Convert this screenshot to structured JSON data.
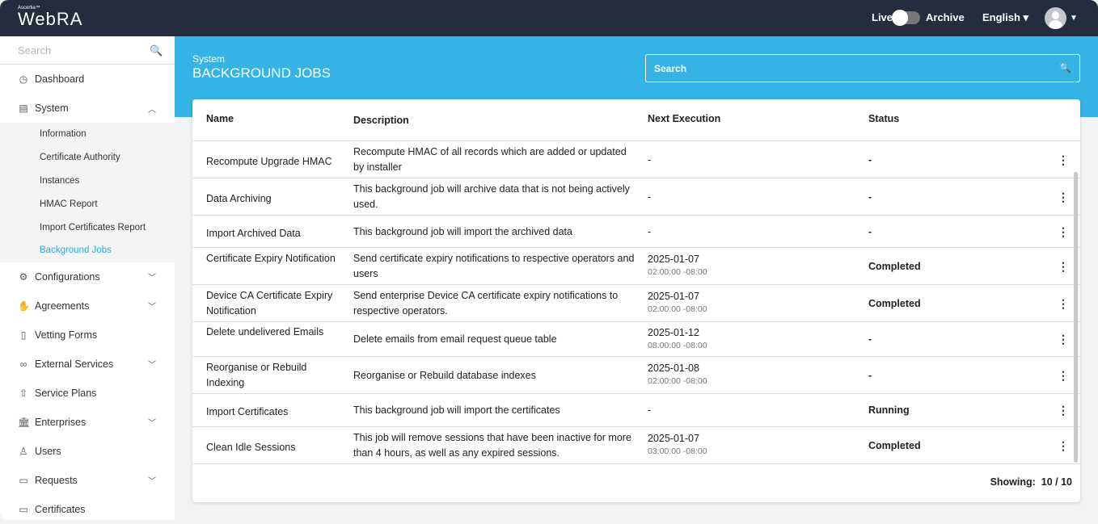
{
  "app": {
    "brand_small": "Ascertia™",
    "brand": "WebRA",
    "live": "Live",
    "archive": "Archive",
    "language": "English ▾"
  },
  "sidebar": {
    "search_placeholder": "Search",
    "items": [
      {
        "label": "Dashboard",
        "icon": "◷"
      },
      {
        "label": "System",
        "icon": "▤"
      }
    ],
    "sub": [
      "Information",
      "Certificate Authority",
      "Instances",
      "HMAC Report",
      "Import Certificates Report",
      "Background Jobs"
    ],
    "items2": [
      {
        "label": "Configurations",
        "icon": "⚙",
        "chev": true
      },
      {
        "label": "Agreements",
        "icon": "✋",
        "chev": true
      },
      {
        "label": "Vetting Forms",
        "icon": "▯",
        "chev": false
      },
      {
        "label": "External Services",
        "icon": "∞",
        "chev": true
      },
      {
        "label": "Service Plans",
        "icon": "⇧",
        "chev": false
      },
      {
        "label": "Enterprises",
        "icon": "🏛",
        "chev": true
      },
      {
        "label": "Users",
        "icon": "♙",
        "chev": false
      },
      {
        "label": "Requests",
        "icon": "▭",
        "chev": true
      },
      {
        "label": "Certificates",
        "icon": "▭",
        "chev": false
      }
    ]
  },
  "page": {
    "crumb": "System",
    "title": "BACKGROUND JOBS",
    "search_placeholder": "Search"
  },
  "table": {
    "headers": [
      "Name",
      "Description",
      "Next Execution",
      "Status"
    ],
    "rows": [
      {
        "name": "Recompute Upgrade HMAC",
        "desc": "Recompute HMAC of all records which are added or updated by installer",
        "date": "-",
        "time": "",
        "status": "-",
        "h": 46
      },
      {
        "name": "Data Archiving",
        "desc": "This background job will archive data that is not being actively used.",
        "date": "-",
        "time": "",
        "status": "-",
        "h": 46
      },
      {
        "name": "Import Archived Data",
        "desc": "This background job will import the archived data",
        "date": "-",
        "time": "",
        "status": "-",
        "h": 40
      },
      {
        "name": "Certificate Expiry Notification",
        "desc": "Send certificate expiry notifications to respective operators and users",
        "date": "2025-01-07",
        "time": "02:00:00 -08:00",
        "status": "Completed",
        "h": 46
      },
      {
        "name": "Device CA Certificate Expiry Notification",
        "desc": "Send enterprise Device CA certificate expiry notifications to respective operators.",
        "date": "2025-01-07",
        "time": "02:00:00 -08:00",
        "status": "Completed",
        "h": 46
      },
      {
        "name": "Delete undelivered Emails",
        "desc": "Delete emails from email request queue table",
        "date": "2025-01-12",
        "time": "08:00:00 -08:00",
        "status": "-",
        "h": 43
      },
      {
        "name": "Reorganise or Rebuild Indexing",
        "desc": "Reorganise or Rebuild database indexes",
        "date": "2025-01-08",
        "time": "02:00:00 -08:00",
        "status": "-",
        "h": 46
      },
      {
        "name": "Import Certificates",
        "desc": "This background job will import the certificates",
        "date": "-",
        "time": "",
        "status": "Running",
        "h": 41
      },
      {
        "name": "Clean Idle Sessions",
        "desc": "This job will remove sessions that have been inactive for more than 4 hours, as well as any expired sessions.",
        "date": "2025-01-07",
        "time": "03:00:00 -08:00",
        "status": "Completed",
        "h": 46
      }
    ]
  },
  "footer": {
    "label": "Showing:",
    "value": "10 / 10"
  }
}
